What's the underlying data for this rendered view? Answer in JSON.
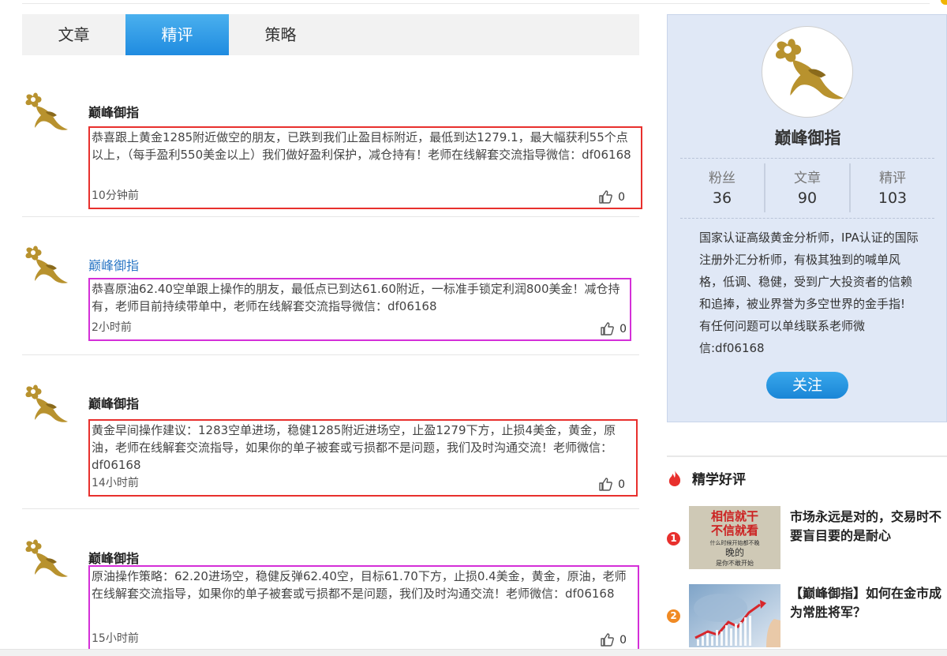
{
  "tabs": [
    {
      "label": "文章"
    },
    {
      "label": "精评"
    },
    {
      "label": "策略"
    }
  ],
  "posts": [
    {
      "author": "巅峰御指",
      "text": "恭喜跟上黄金1285附近做空的朋友，已跌到我们止盈目标附近，最低到达1279.1，最大幅获利55个点以上，（每手盈利550美金以上）我们做好盈利保护，减仓持有！老师在线解套交流指导微信：df06168",
      "time": "10分钟前",
      "likes": "0"
    },
    {
      "author": "巅峰御指",
      "text": "恭喜原油62.40空单跟上操作的朋友，最低点已到达61.60附近，一标准手锁定利润800美金！减仓持有，老师目前持续带单中，老师在线解套交流指导微信：df06168",
      "time": "2小时前",
      "likes": "0"
    },
    {
      "author": "巅峰御指",
      "text": "黄金早间操作建议：1283空单进场，稳健1285附近进场空，止盈1279下方，止损4美金，黄金，原油，老师在线解套交流指导，如果你的单子被套或亏损都不是问题，我们及时沟通交流！老师微信：df06168",
      "time": "14小时前",
      "likes": "0"
    },
    {
      "author": "巅峰御指",
      "text": "原油操作策略：62.20进场空，稳健反弹62.40空，目标61.70下方，止损0.4美金，黄金，原油，老师在线解套交流指导，如果你的单子被套或亏损都不是问题，我们及时沟通交流！老师微信：df06168",
      "time": "15小时前",
      "likes": "0"
    }
  ],
  "profile": {
    "name": "巅峰御指",
    "stats": [
      {
        "label": "粉丝",
        "value": "36"
      },
      {
        "label": "文章",
        "value": "90"
      },
      {
        "label": "精评",
        "value": "103"
      }
    ],
    "bio": "国家认证高级黄金分析师，IPA认证的国际注册外汇分析师，有极其独到的喊单风格，低调、稳健，受到广大投资者的信赖和追捧，被业界誉为多空世界的金手指! 有任何问题可以单线联系老师微信:df06168",
    "follow_label": "关注"
  },
  "sidebar": {
    "section_title": "精学好评",
    "items": [
      {
        "rank": "1",
        "title": "市场永远是对的，交易时不要盲目要的是耐心",
        "thumb_text_1": "相信就干",
        "thumb_text_2": "不信就看",
        "thumb_text_3": "什么时候开始都不晚",
        "thumb_text_4": "晚的",
        "thumb_text_5": "是你不敢开始",
        "rank_color": "#e8302d"
      },
      {
        "rank": "2",
        "title": "【巅峰御指】如何在金市成为常胜将军？",
        "rank_color": "#f08a24"
      }
    ]
  },
  "colors": {
    "accent": "#1f8be0",
    "border_red": "#e8302d",
    "border_pink": "#d42fd8",
    "gold": "#b8922e"
  }
}
